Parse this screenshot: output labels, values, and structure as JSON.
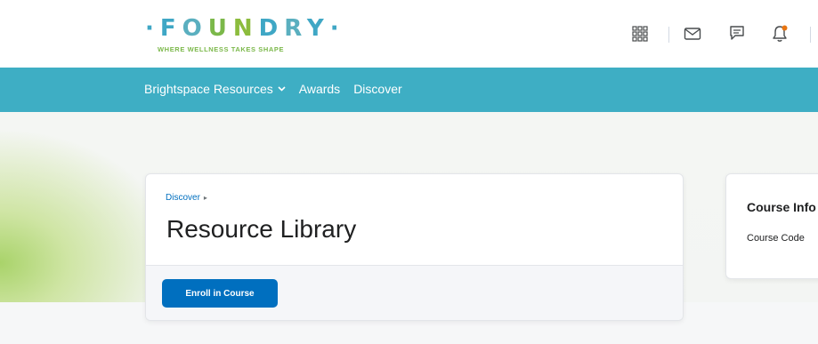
{
  "brand": {
    "name": "FOUNDRY",
    "tagline": "WHERE WELLNESS TAKES SHAPE",
    "letter_colors": [
      "#3fa7c5",
      "#5aafbf",
      "#7bb84a",
      "#8cbc3d",
      "#3fa7c5",
      "#5aafbf",
      "#3fa7c5"
    ]
  },
  "header_icons": [
    "app-grid-icon",
    "mail-icon",
    "chat-icon",
    "bell-icon"
  ],
  "nav": {
    "items": [
      {
        "label": "Brightspace Resources",
        "has_dropdown": true
      },
      {
        "label": "Awards"
      },
      {
        "label": "Discover"
      }
    ]
  },
  "main_card": {
    "breadcrumb": "Discover",
    "title": "Resource Library",
    "enroll_button": "Enroll in Course"
  },
  "side_card": {
    "title": "Course Info",
    "code_label": "Course Code"
  },
  "colors": {
    "nav_bg": "#3eaec4",
    "primary": "#006fbf",
    "notification_dot": "#e87511"
  }
}
